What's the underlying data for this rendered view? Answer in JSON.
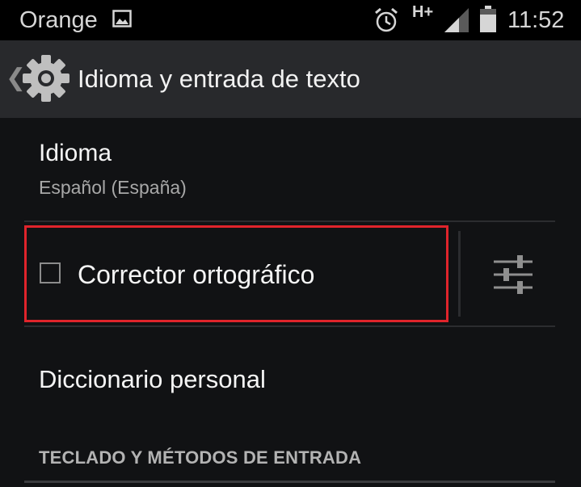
{
  "status_bar": {
    "carrier": "Orange",
    "network_type": "H+",
    "time": "11:52",
    "icons": [
      "image-icon",
      "alarm-icon",
      "signal-icon",
      "battery-icon"
    ]
  },
  "action_bar": {
    "title": "Idioma y entrada de texto",
    "back_glyph": "❮",
    "icon": "settings-gear-icon"
  },
  "settings_list": {
    "language": {
      "title": "Idioma",
      "value": "Español (España)"
    },
    "spell_checker": {
      "label": "Corrector ortográfico",
      "checked": false,
      "settings_icon": "sliders-icon"
    },
    "personal_dictionary": {
      "label": "Diccionario personal"
    },
    "section_header": "TECLADO Y MÉTODOS DE ENTRADA"
  },
  "colors": {
    "status_bar_bg": "#000000",
    "action_bar_bg": "#28292c",
    "page_bg": "#111214",
    "highlight_border": "#e0242b"
  }
}
